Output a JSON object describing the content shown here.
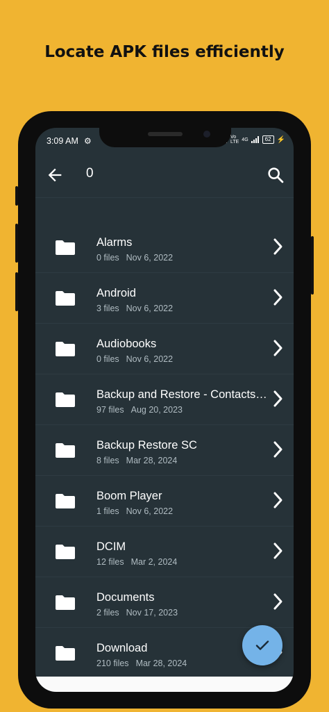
{
  "headline": "Locate APK files efficiently",
  "status": {
    "time": "3:09 AM",
    "battery": "62",
    "network": "4G"
  },
  "appbar": {
    "query": "0"
  },
  "folders": [
    {
      "name": "Alarms",
      "count": "0 files",
      "date": "Nov 6, 2022"
    },
    {
      "name": "Android",
      "count": "3 files",
      "date": "Nov 6, 2022"
    },
    {
      "name": "Audiobooks",
      "count": "0 files",
      "date": "Nov 6, 2022"
    },
    {
      "name": "Backup and Restore - Contacts and...",
      "count": "97 files",
      "date": "Aug 20, 2023"
    },
    {
      "name": "Backup Restore SC",
      "count": "8 files",
      "date": "Mar 28, 2024"
    },
    {
      "name": "Boom Player",
      "count": "1 files",
      "date": "Nov 6, 2022"
    },
    {
      "name": "DCIM",
      "count": "12 files",
      "date": "Mar 2, 2024"
    },
    {
      "name": "Documents",
      "count": "2 files",
      "date": "Nov 17, 2023"
    },
    {
      "name": "Download",
      "count": "210 files",
      "date": "Mar 28, 2024"
    }
  ],
  "icons": {
    "back": "arrow-left-icon",
    "search": "search-icon",
    "folder": "folder-icon",
    "chevron": "chevron-right-icon",
    "fab": "check-icon"
  },
  "colors": {
    "background": "#f0b431",
    "screen": "#263238",
    "fab": "#74b3e8"
  }
}
